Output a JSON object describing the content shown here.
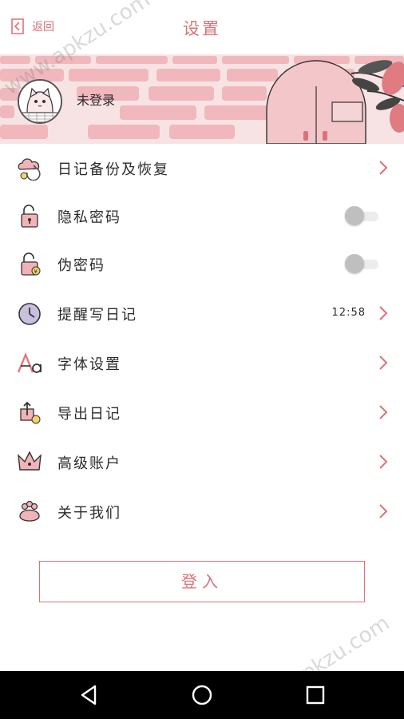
{
  "header": {
    "back_label": "返回",
    "title": "设置"
  },
  "profile": {
    "username": "未登录"
  },
  "menu": {
    "items": [
      {
        "label": "日记备份及恢复",
        "icon": "cloud-sync-icon"
      },
      {
        "label": "隐私密码",
        "icon": "lock-icon"
      },
      {
        "label": "伪密码",
        "icon": "fake-lock-icon"
      },
      {
        "label": "提醒写日记",
        "icon": "clock-icon",
        "value": "12:58"
      },
      {
        "label": "字体设置",
        "icon": "font-icon"
      },
      {
        "label": "导出日记",
        "icon": "export-icon"
      },
      {
        "label": "高级账户",
        "icon": "crown-icon"
      },
      {
        "label": "关于我们",
        "icon": "paw-icon"
      }
    ],
    "toggles": {
      "privacy_password": false,
      "fake_password": false
    }
  },
  "login": {
    "label": "登入"
  },
  "watermark": "www.apkzu.com",
  "colors": {
    "accent": "#d9737a",
    "banner_bg": "#f7e3e4",
    "brick": "#eeaab0",
    "navbar": "#000000"
  }
}
